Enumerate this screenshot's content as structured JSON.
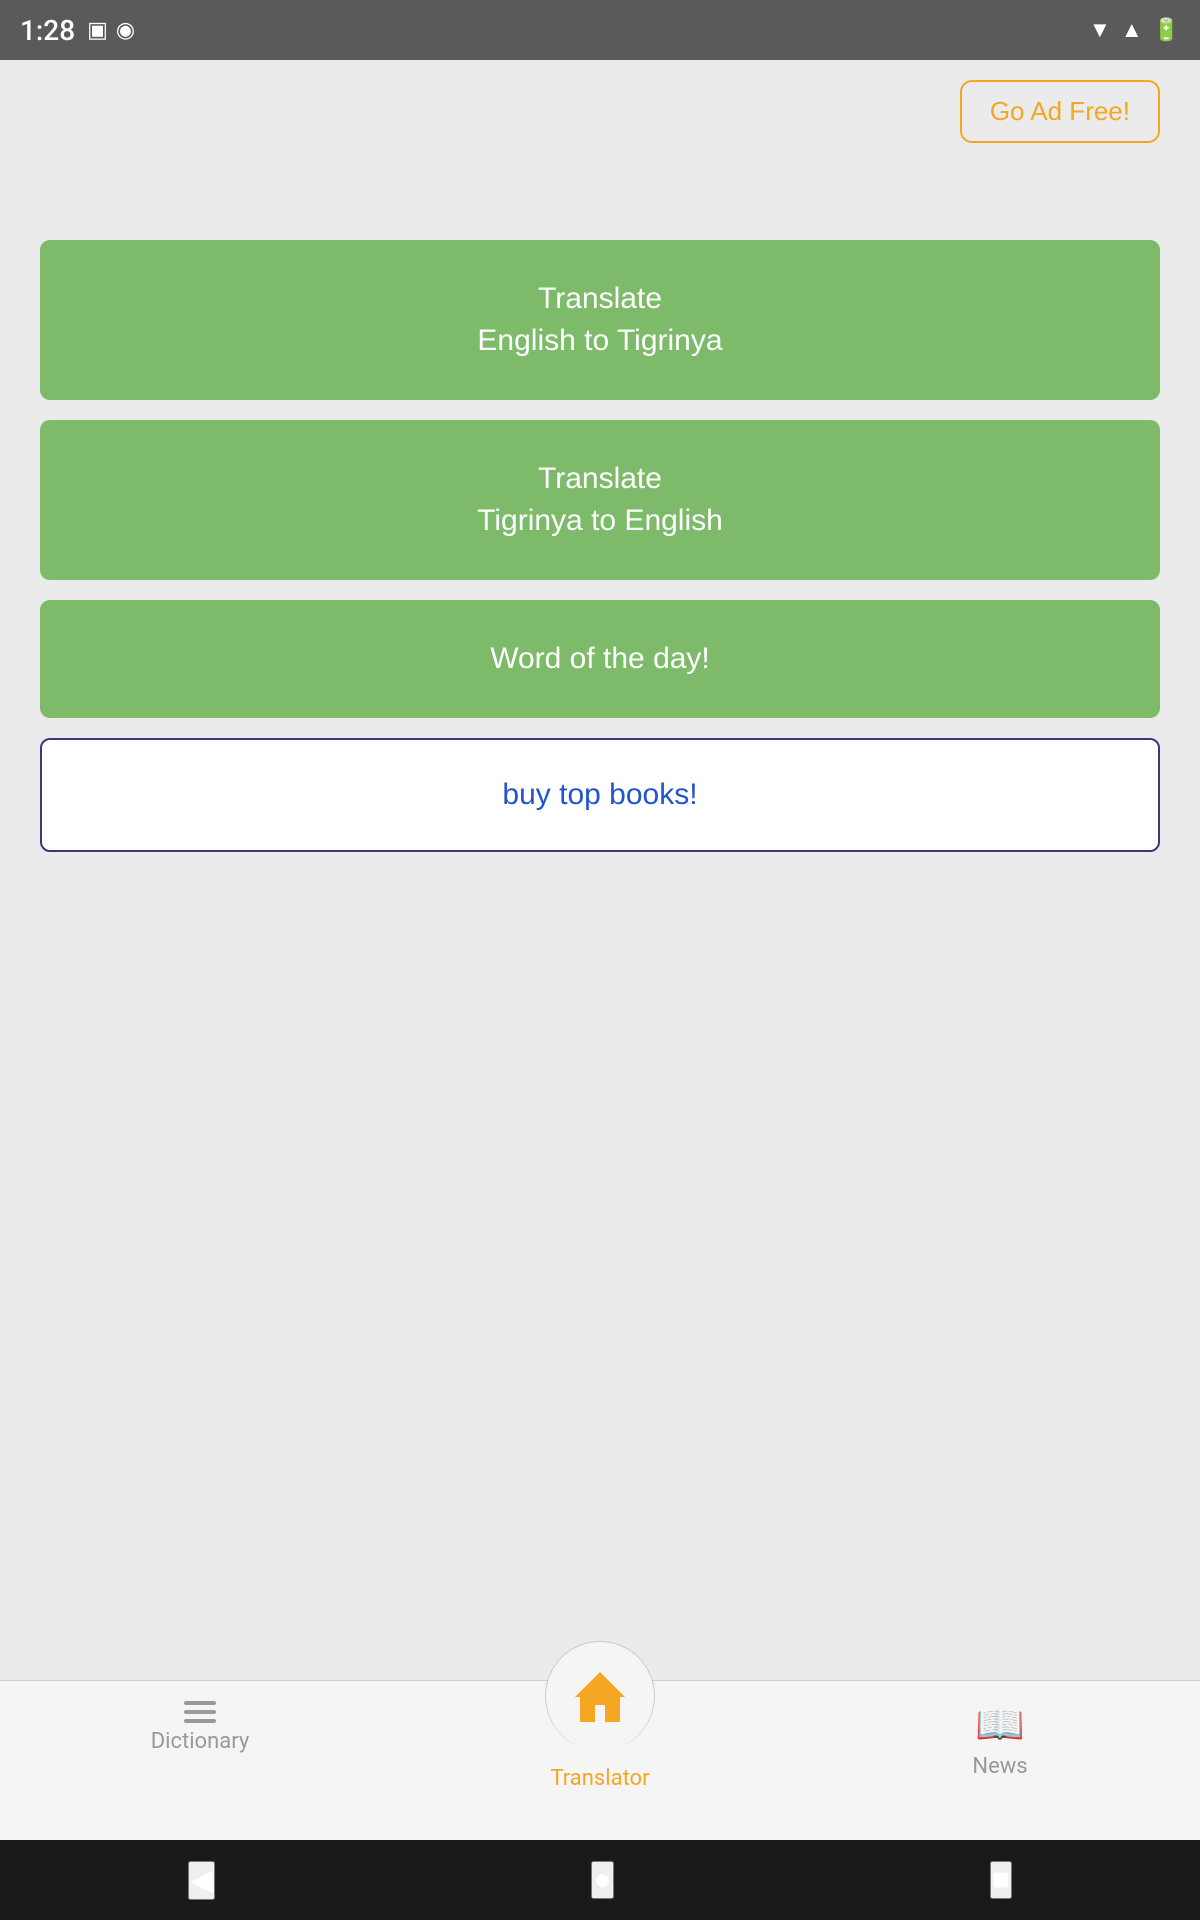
{
  "statusBar": {
    "time": "1:28",
    "icons": [
      "sim-card-icon",
      "circle-logo-icon"
    ],
    "rightIcons": [
      "wifi-icon",
      "signal-icon",
      "battery-icon"
    ]
  },
  "adFreeButton": {
    "label": "Go Ad Free!"
  },
  "buttons": {
    "translateEngToTig": {
      "line1": "Translate",
      "line2": "English to Tigrinya"
    },
    "translateTigToEng": {
      "line1": "Translate",
      "line2": "Tigrinya to English"
    },
    "wordOfTheDay": {
      "label": "Word of the day!"
    },
    "buyTopBooks": {
      "label": "buy top books!"
    }
  },
  "bottomNav": {
    "items": [
      {
        "label": "Dictionary",
        "icon": "list-icon",
        "active": false
      },
      {
        "label": "Translator",
        "icon": "home-icon",
        "active": true
      },
      {
        "label": "News",
        "icon": "book-icon",
        "active": false
      }
    ]
  },
  "androidNav": {
    "back": "◀",
    "home": "●",
    "recent": "■"
  }
}
